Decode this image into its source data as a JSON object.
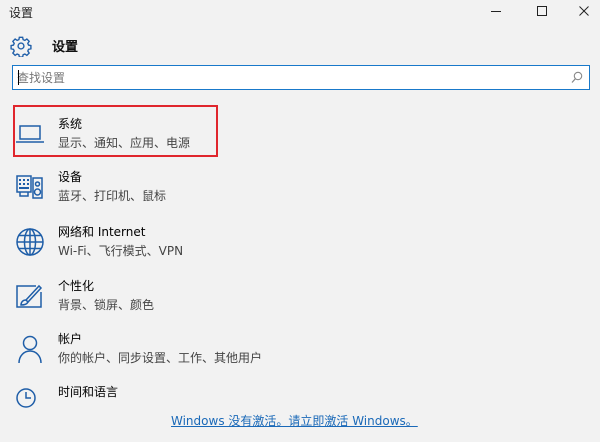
{
  "window": {
    "title": "设置",
    "controls": {
      "minimize": "minimize",
      "maximize": "maximize",
      "close": "close"
    }
  },
  "header": {
    "title": "设置",
    "icon": "gear-icon"
  },
  "search": {
    "placeholder": "查找设置",
    "value": ""
  },
  "categories": [
    {
      "name": "系统",
      "desc": "显示、通知、应用、电源",
      "icon": "laptop-icon",
      "highlighted": true
    },
    {
      "name": "设备",
      "desc": "蓝牙、打印机、鼠标",
      "icon": "devices-icon"
    },
    {
      "name": "网络和 Internet",
      "desc": "Wi-Fi、飞行模式、VPN",
      "icon": "globe-icon"
    },
    {
      "name": "个性化",
      "desc": "背景、锁屏、颜色",
      "icon": "paintbrush-icon"
    },
    {
      "name": "帐户",
      "desc": "你的帐户、同步设置、工作、其他用户",
      "icon": "person-icon"
    },
    {
      "name": "时间和语言",
      "desc": "",
      "icon": "clock-icon"
    }
  ],
  "activation": {
    "text": "Windows 没有激活。请立即激活 Windows。"
  },
  "colors": {
    "accent": "#1979ca",
    "highlight_border": "#e0262d",
    "link": "#1a69b8",
    "background": "#f2f2f2"
  }
}
